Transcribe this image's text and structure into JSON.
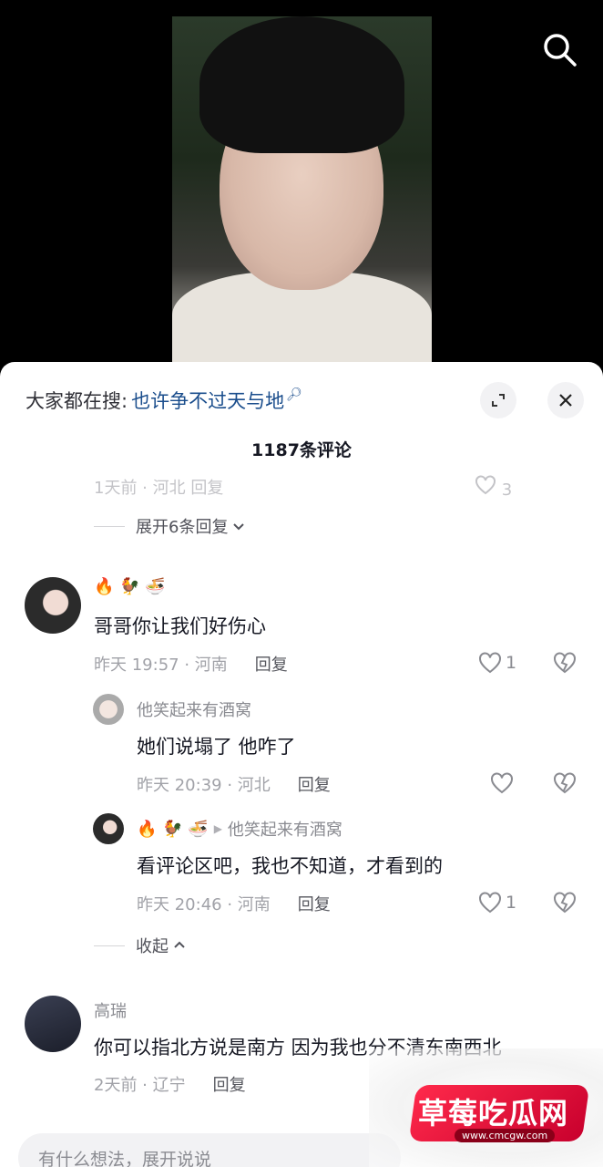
{
  "top": {
    "search_icon": "search-icon"
  },
  "panel": {
    "search_prefix": "大家都在搜:",
    "search_keyword": "也许争不过天与地",
    "comment_count": "1187条评论",
    "faded_row_text": "1天前 · 河北    回复",
    "faded_like_count": "3",
    "expand_replies": "展开6条回复",
    "collapse": "收起"
  },
  "comments": [
    {
      "name_emojis": "🔥 🐓 🍜",
      "text": "哥哥你让我们好伤心",
      "time_loc": "昨天 19:57 · 河南",
      "reply": "回复",
      "likes": "1"
    },
    {
      "name": "他笑起来有酒窝",
      "text": "她们说塌了 他咋了",
      "time_loc": "昨天 20:39 · 河北",
      "reply": "回复",
      "likes": ""
    },
    {
      "name_emojis": "🔥 🐓 🍜",
      "reply_to": "他笑起来有酒窝",
      "text": "看评论区吧，我也不知道，才看到的",
      "time_loc": "昨天 20:46 · 河南",
      "reply": "回复",
      "likes": "1"
    },
    {
      "name": "高瑞",
      "text": "你可以指北方说是南方 因为我也分不清东南西北",
      "time_loc": "2天前 · 辽宁",
      "reply": "回复"
    }
  ],
  "input": {
    "placeholder": "有什么想法，展开说说"
  },
  "watermark": {
    "title": "草莓吃瓜网",
    "url": "www.cmcgw.com"
  },
  "colors": {
    "keyword": "#1a4d8c",
    "muted": "#a1a2a8",
    "text": "#161823",
    "watermark": "#e0163a"
  }
}
